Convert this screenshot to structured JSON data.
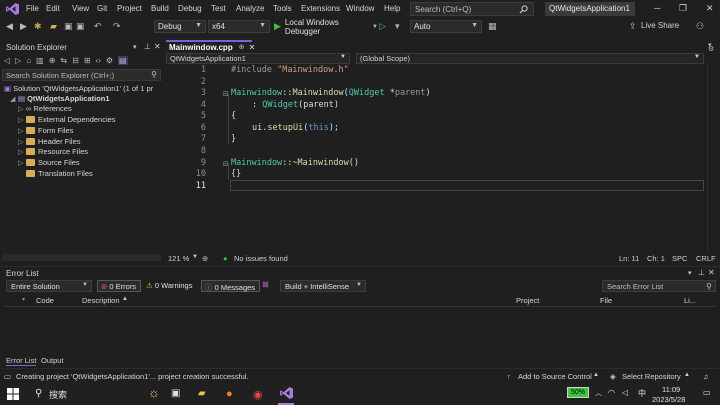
{
  "menubar": {
    "items": [
      "File",
      "Edit",
      "View",
      "Git",
      "Project",
      "Build",
      "Debug",
      "Test",
      "Analyze",
      "Tools",
      "Extensions",
      "Window",
      "Help"
    ],
    "search_placeholder": "Search (Ctrl+Q)",
    "solution_name": "QtWidgetsApplication1"
  },
  "toolbar": {
    "configuration": "Debug",
    "platform": "x64",
    "run_label": "Local Windows Debugger",
    "auto": "Auto",
    "live_share": "Live Share"
  },
  "solution_explorer": {
    "title": "Solution Explorer",
    "search_placeholder": "Search Solution Explorer (Ctrl+;)",
    "solution": "Solution 'QtWidgetsApplication1' (1 of 1 pr",
    "project": "QtWidgetsApplication1",
    "items": [
      "References",
      "External Dependencies",
      "Form Files",
      "Header Files",
      "Resource Files",
      "Source Files",
      "Translation Files"
    ]
  },
  "editor": {
    "tab_label": "Mainwindow.cpp",
    "nav_project": "QtWidgetsApplication1",
    "nav_scope": "(Global Scope)",
    "line_numbers": [
      "1",
      "2",
      "3",
      "4",
      "5",
      "6",
      "7",
      "8",
      "9",
      "10",
      "11"
    ],
    "code": {
      "l1_directive": "#include",
      "l1_file": "\"Mainwindow.h\"",
      "l3_class": "Mainwindow",
      "l3_sep": "::",
      "l3_fn": "Mainwindow",
      "l3_open": "(",
      "l3_type": "QWidget",
      "l3_star": " *",
      "l3_param": "parent",
      "l3_close": ")",
      "l4_colon": ": ",
      "l4_base": "QWidget",
      "l4_arg": "(parent)",
      "l5": "{",
      "l6_obj": "ui",
      "l6_dot": ".",
      "l6_fn": "setupUi",
      "l6_open": "(",
      "l6_this": "this",
      "l6_close": ");",
      "l7": "}",
      "l9_class": "Mainwindow",
      "l9_sep": "::",
      "l9_fn": "~Mainwindow",
      "l9_parens": "()",
      "l10": "{}"
    },
    "zoom": "121 %",
    "issues": "No issues found",
    "ln": "Ln: 11",
    "ch": "Ch: 1",
    "spc": "SPC",
    "crlf": "CRLF"
  },
  "error_list": {
    "title": "Error List",
    "scope": "Entire Solution",
    "errors": "0 Errors",
    "warnings": "0 Warnings",
    "messages": "0 Messages",
    "build_filter": "Build + IntelliSense",
    "search_placeholder": "Search Error List",
    "columns": {
      "code": "Code",
      "description": "Description",
      "project": "Project",
      "file": "File",
      "line": "Li..."
    },
    "tabs": [
      "Error List",
      "Output"
    ]
  },
  "statusbar": {
    "message": "Creating project 'QtWidgetsApplication1'... project creation successful.",
    "source_control": "Add to Source Control",
    "repository": "Select Repository"
  },
  "taskbar": {
    "search_label": "搜索",
    "battery": "50%",
    "ime": "中",
    "time": "11:09",
    "date": "2023/5/28"
  },
  "colors": {
    "accent": "#7a61d6",
    "keyword": "#569cd6",
    "type": "#4ec9b0",
    "function": "#dcdcaa",
    "string": "#d69d85"
  }
}
